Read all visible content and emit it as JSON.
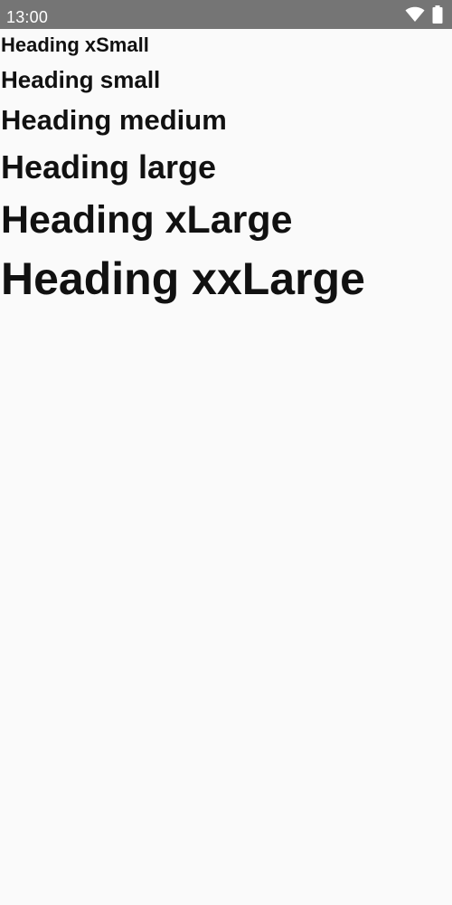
{
  "status_bar": {
    "time": "13:00",
    "icons": [
      "wifi-icon",
      "battery-icon"
    ],
    "background": "#757575",
    "text_color": "#ffffff"
  },
  "headings": {
    "xsmall": "Heading xSmall",
    "small": "Heading small",
    "medium": "Heading medium",
    "large": "Heading large",
    "xlarge": "Heading xLarge",
    "xxlarge": "Heading xxLarge"
  },
  "colors": {
    "page_background": "#fafafa",
    "heading_text": "#111111"
  }
}
